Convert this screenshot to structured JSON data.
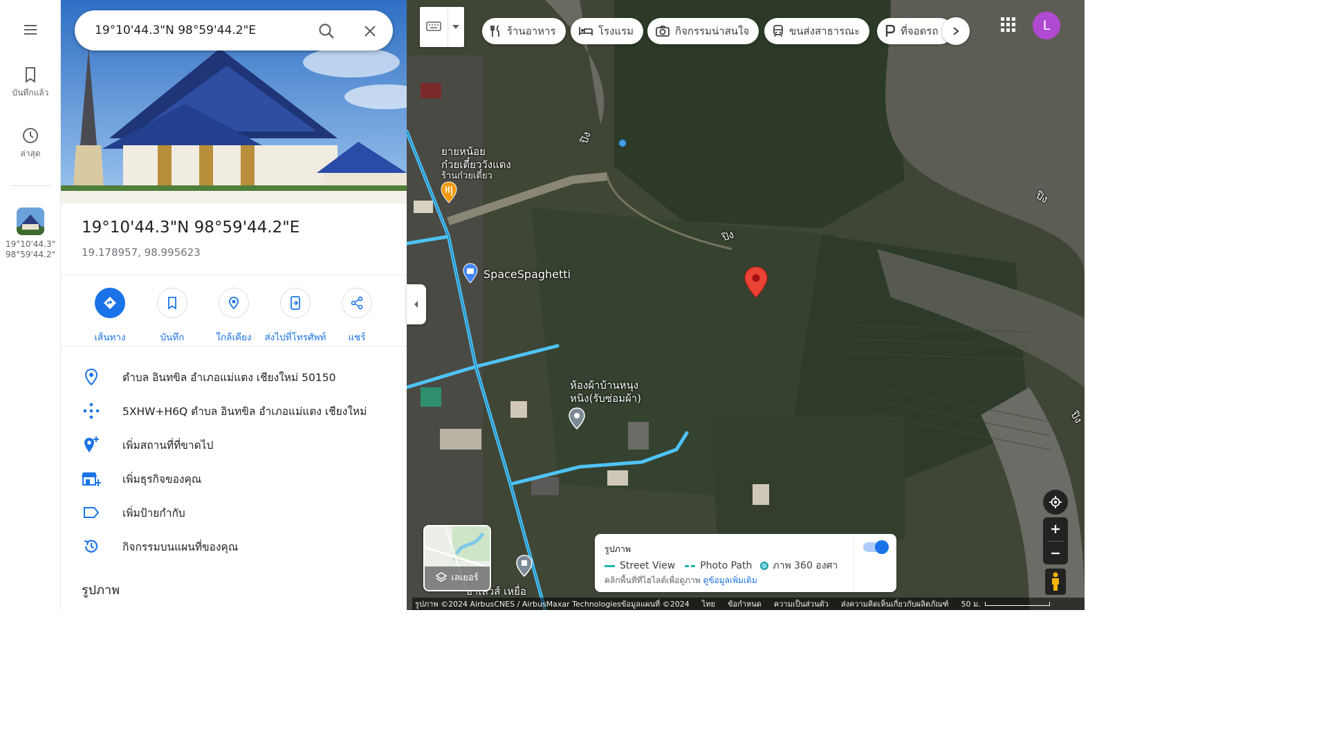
{
  "rail": {
    "saved_label": "บันทึกแล้ว",
    "recent_label": "ล่าสุด",
    "recent_item_label_line1": "19°10'44.3\"",
    "recent_item_label_line2": "98°59'44.2\""
  },
  "search": {
    "value": "19°10'44.3\"N 98°59'44.2\"E"
  },
  "place": {
    "title": "19°10'44.3\"N 98°59'44.2\"E",
    "decimal": "19.178957, 98.995623"
  },
  "actions": [
    {
      "label": "เส้นทาง"
    },
    {
      "label": "บันทึก"
    },
    {
      "label": "ใกล้เคียง"
    },
    {
      "label": "ส่งไปที่โทรศัพท์"
    },
    {
      "label": "แชร์"
    }
  ],
  "info": {
    "address": "ตำบล อินทขิล อำเภอแม่แตง เชียงใหม่ 50150",
    "plus_code": "5XHW+H6Q ตำบล อินทขิล อำเภอแม่แตง เชียงใหม่",
    "add_missing_place": "เพิ่มสถานที่ที่ขาดไป",
    "add_business": "เพิ่มธุรกิจของคุณ",
    "add_label": "เพิ่มป้ายกำกับ",
    "map_activity": "กิจกรรมบนแผนที่ของคุณ"
  },
  "photos_heading": "รูปภาพ",
  "chips": [
    {
      "label": "ร้านอาหาร",
      "icon": "restaurant-icon"
    },
    {
      "label": "โรงแรม",
      "icon": "hotel-icon"
    },
    {
      "label": "กิจกรรมน่าสนใจ",
      "icon": "camera-icon"
    },
    {
      "label": "ขนส่งสาธารณะ",
      "icon": "transit-icon"
    },
    {
      "label": "ที่จอดรถ",
      "icon": "parking-icon"
    }
  ],
  "avatar_letter": "L",
  "map_labels": {
    "restaurant_line1": "ยายหน้อย",
    "restaurant_line2": "ก๋วยเตี๋ยววังแดง",
    "restaurant_line3": "ร้านก๋วยเตี๋ยว",
    "space_spaghetti": "SpaceSpaghetti",
    "shop_line1": "ห้องผ้าบ้านหนุง",
    "shop_line2": "หนิง(รับซ่อมผ้า)",
    "river1": "ปิง",
    "river2": "ปิง",
    "river3": "ปิง",
    "river4": "ปิง",
    "bottom_place": "อาเลวส์ เหยื่อ"
  },
  "layers_label": "เลเยอร์",
  "legend": {
    "title": "รูปภาพ",
    "street_view": "Street View",
    "photo_path": "Photo Path",
    "photo_360": "ภาพ 360 องศา",
    "note": "คลิกพื้นที่ที่ไฮไลต์เพื่อดูภาพ",
    "note_link": "ดูข้อมูลเพิ่มเติม"
  },
  "footer": {
    "imagery": "รูปภาพ ©2024 AirbusCNES / AirbusMaxar Technologiesข้อมูลแผนที่ ©2024",
    "lang": "ไทย",
    "terms": "ข้อกำหนด",
    "privacy": "ความเป็นส่วนตัว",
    "feedback": "ส่งความคิดเห็นเกี่ยวกับผลิตภัณฑ์",
    "scale": "50 ม."
  },
  "colors": {
    "accent": "#1a73e8",
    "pin": "#ea4335",
    "street_view_line": "#4fc3f7",
    "avatar": "#b04ad2"
  }
}
